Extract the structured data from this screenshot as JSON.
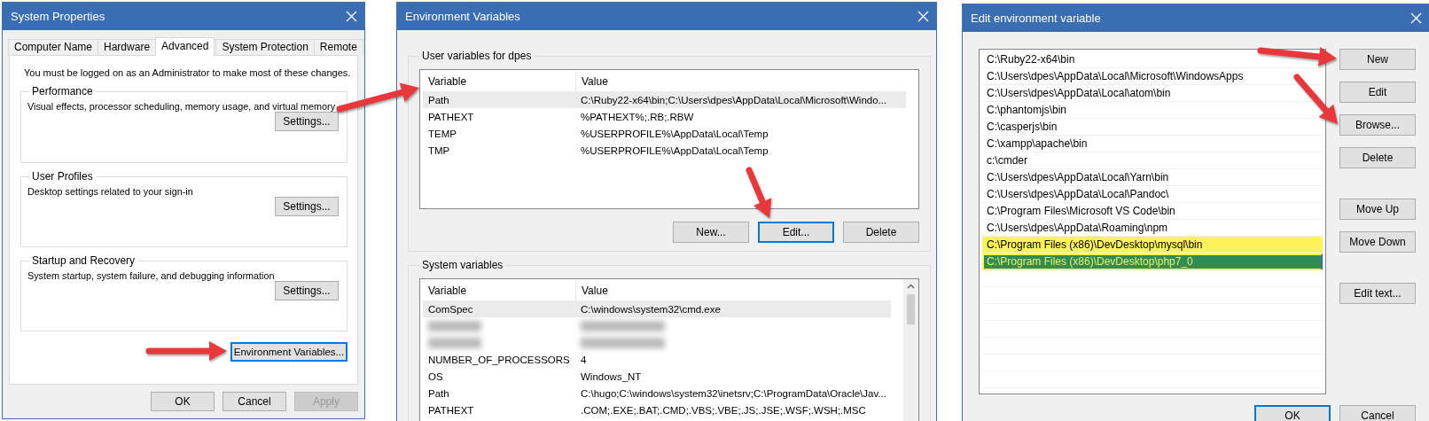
{
  "system_properties": {
    "title": "System Properties",
    "tabs": [
      {
        "label": "Computer Name",
        "selected": false
      },
      {
        "label": "Hardware",
        "selected": false
      },
      {
        "label": "Advanced",
        "selected": true
      },
      {
        "label": "System Protection",
        "selected": false
      },
      {
        "label": "Remote",
        "selected": false
      }
    ],
    "notice": "You must be logged on as an Administrator to make most of these changes.",
    "groups": [
      {
        "title": "Performance",
        "description": "Visual effects, processor scheduling, memory usage, and virtual memory",
        "button": "Settings..."
      },
      {
        "title": "User Profiles",
        "description": "Desktop settings related to your sign-in",
        "button": "Settings..."
      },
      {
        "title": "Startup and Recovery",
        "description": "System startup, system failure, and debugging information",
        "button": "Settings..."
      }
    ],
    "env_button": {
      "label": "Environment Variables...",
      "focused": true,
      "arrow": true
    },
    "buttons": [
      {
        "label": "OK",
        "disabled": false
      },
      {
        "label": "Cancel",
        "disabled": false
      },
      {
        "label": "Apply",
        "disabled": true
      }
    ]
  },
  "environment_variables": {
    "title": "Environment Variables",
    "user_group": {
      "title": "User variables for dpes",
      "columns": [
        "Variable",
        "Value"
      ],
      "rows": [
        {
          "kind": "text",
          "variable": "Path",
          "value": "C:\\Ruby22-x64\\bin;C:\\Users\\dpes\\AppData\\Local\\Microsoft\\Windo...",
          "selected": true,
          "arrow": true
        },
        {
          "kind": "text",
          "variable": "PATHEXT",
          "value": "%PATHEXT%;.RB;.RBW",
          "selected": false
        },
        {
          "kind": "text",
          "variable": "TEMP",
          "value": "%USERPROFILE%\\AppData\\Local\\Temp",
          "selected": false
        },
        {
          "kind": "text",
          "variable": "TMP",
          "value": "%USERPROFILE%\\AppData\\Local\\Temp",
          "selected": false
        }
      ],
      "buttons": [
        {
          "label": "New...",
          "focused": false
        },
        {
          "label": "Edit...",
          "focused": true,
          "arrow": true
        },
        {
          "label": "Delete",
          "focused": false
        }
      ]
    },
    "system_group": {
      "title": "System variables",
      "columns": [
        "Variable",
        "Value"
      ],
      "rows": [
        {
          "kind": "text",
          "variable": "ComSpec",
          "value": "C:\\windows\\system32\\cmd.exe",
          "selected": true
        },
        {
          "kind": "blurred",
          "selected": false
        },
        {
          "kind": "blurred",
          "selected": false
        },
        {
          "kind": "text",
          "variable": "NUMBER_OF_PROCESSORS",
          "value": "4",
          "selected": false
        },
        {
          "kind": "text",
          "variable": "OS",
          "value": "Windows_NT",
          "selected": false
        },
        {
          "kind": "text",
          "variable": "Path",
          "value": "C:\\hugo;C:\\windows\\system32\\inetsrv;C:\\ProgramData\\Oracle\\Jav...",
          "selected": false
        },
        {
          "kind": "text",
          "variable": "PATHEXT",
          "value": ".COM;.EXE;.BAT;.CMD;.VBS;.VBE;.JS;.JSE;.WSF;.WSH;.MSC",
          "selected": false
        }
      ]
    }
  },
  "edit_variable": {
    "title": "Edit environment variable",
    "entries": [
      {
        "text": "C:\\Ruby22-x64\\bin",
        "selected": false,
        "highlighted": false
      },
      {
        "text": "C:\\Users\\dpes\\AppData\\Local\\Microsoft\\WindowsApps",
        "selected": false,
        "highlighted": false
      },
      {
        "text": "C:\\Users\\dpes\\AppData\\Local\\atom\\bin",
        "selected": false,
        "highlighted": false
      },
      {
        "text": "C:\\phantomjs\\bin",
        "selected": false,
        "highlighted": false
      },
      {
        "text": "C:\\casperjs\\bin",
        "selected": false,
        "highlighted": false
      },
      {
        "text": "C:\\xampp\\apache\\bin",
        "selected": false,
        "highlighted": false
      },
      {
        "text": "c:\\cmder",
        "selected": false,
        "highlighted": false
      },
      {
        "text": "C:\\Users\\dpes\\AppData\\Local\\Yarn\\bin",
        "selected": false,
        "highlighted": false
      },
      {
        "text": "C:\\Users\\dpes\\AppData\\Local\\Pandoc\\",
        "selected": false,
        "highlighted": false
      },
      {
        "text": "C:\\Program Files\\Microsoft VS Code\\bin",
        "selected": false,
        "highlighted": false
      },
      {
        "text": "C:\\Users\\dpes\\AppData\\Roaming\\npm",
        "selected": false,
        "highlighted": false
      },
      {
        "text": "C:\\Program Files (x86)\\DevDesktop\\mysql\\bin",
        "selected": false,
        "highlighted": true
      },
      {
        "text": "C:\\Program Files (x86)\\DevDesktop\\php7_0",
        "selected": true,
        "highlighted": true
      }
    ],
    "button_groups": [
      [
        {
          "label": "New",
          "arrow": true
        },
        {
          "label": "Edit"
        },
        {
          "label": "Browse...",
          "arrow": true
        },
        {
          "label": "Delete"
        }
      ],
      [
        {
          "label": "Move Up"
        },
        {
          "label": "Move Down"
        }
      ],
      [
        {
          "label": "Edit text..."
        }
      ]
    ],
    "footer_buttons": [
      {
        "label": "OK",
        "focused": true
      },
      {
        "label": "Cancel",
        "focused": false
      }
    ]
  }
}
